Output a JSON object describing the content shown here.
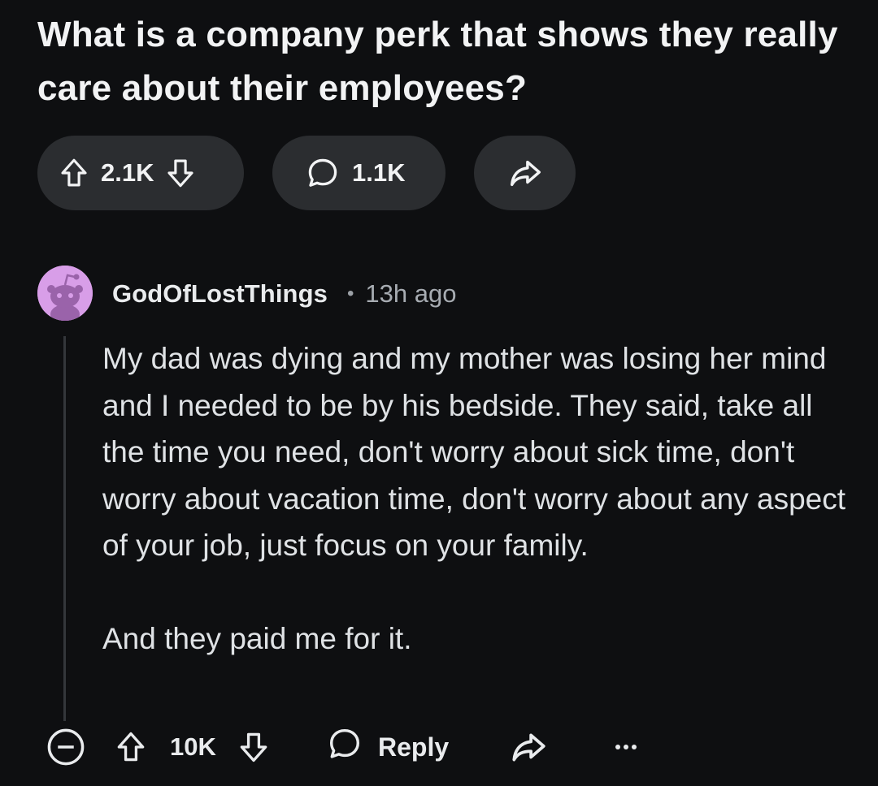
{
  "post": {
    "title": "What is a company perk that shows they really care about their employees?",
    "votes": "2.1K",
    "comments": "1.1K"
  },
  "comment": {
    "username": "GodOfLostThings",
    "separator": "•",
    "timestamp": "13h ago",
    "paragraphs": [
      "My dad was dying and my mother was losing her mind and I needed to be by his bedside. They said, take all the time you need, don't worry about sick time, don't worry about vacation time, don't worry about any aspect of your job, just focus on your family.",
      "And they paid me for it."
    ],
    "score": "10K",
    "reply_label": "Reply"
  },
  "icons": {
    "upvote": "upvote-arrow-icon",
    "downvote": "downvote-arrow-icon",
    "comment": "speech-bubble-icon",
    "share": "share-arrow-icon",
    "collapse": "collapse-minus-icon",
    "more": "more-dots-icon",
    "avatar": "snoo-avatar-icon"
  },
  "colors": {
    "background": "#0e0f11",
    "pill": "#2b2d30",
    "avatar": "#d89ee8",
    "text": "#dfe2e5",
    "muted": "#a7acb2"
  }
}
